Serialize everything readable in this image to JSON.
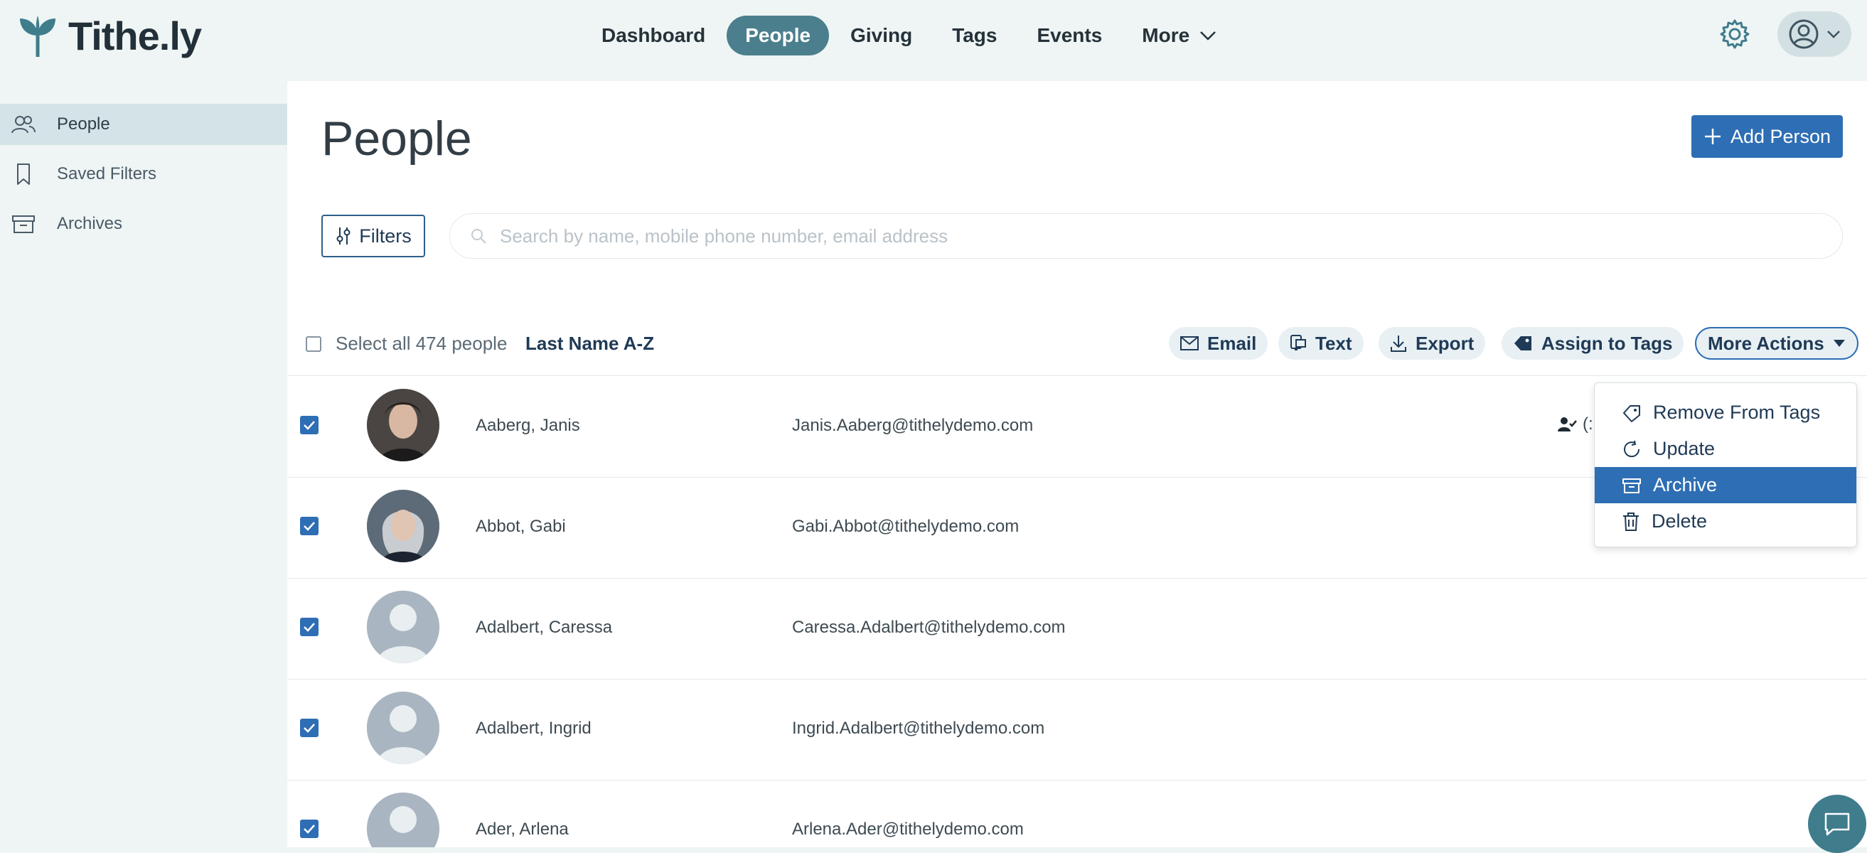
{
  "app": {
    "logo_text": "Tithe.ly",
    "brand_color": "#3f7c8c",
    "accent_color": "#2e6eb4"
  },
  "nav": {
    "items": [
      {
        "label": "Dashboard"
      },
      {
        "label": "People"
      },
      {
        "label": "Giving"
      },
      {
        "label": "Tags"
      },
      {
        "label": "Events"
      },
      {
        "label": "More"
      }
    ],
    "active": "People"
  },
  "sidebar": {
    "items": [
      {
        "label": "People",
        "icon": "people-icon"
      },
      {
        "label": "Saved Filters",
        "icon": "bookmark-icon"
      },
      {
        "label": "Archives",
        "icon": "archive-icon"
      }
    ],
    "active": "People"
  },
  "main": {
    "title": "People",
    "add_button": "Add Person",
    "filters_button": "Filters",
    "search_placeholder": "Search by name, mobile phone number, email address"
  },
  "bulk": {
    "select_all_label": "Select all 474 people",
    "sort_label": "Last Name A-Z",
    "actions": {
      "email": "Email",
      "text": "Text",
      "export": "Export",
      "assign": "Assign to Tags",
      "more": "More Actions"
    }
  },
  "dropdown": {
    "items": [
      {
        "label": "Remove From Tags",
        "icon": "tag-outline-icon"
      },
      {
        "label": "Update",
        "icon": "refresh-icon"
      },
      {
        "label": "Archive",
        "icon": "archive-icon"
      },
      {
        "label": "Delete",
        "icon": "trash-icon"
      }
    ],
    "highlighted": "Archive"
  },
  "people": [
    {
      "name": "Aaberg, Janis",
      "email": "Janis.Aaberg@tithelydemo.com",
      "household": "(:",
      "checked": true
    },
    {
      "name": "Abbot, Gabi",
      "email": "Gabi.Abbot@tithelydemo.com",
      "checked": true
    },
    {
      "name": "Adalbert, Caressa",
      "email": "Caressa.Adalbert@tithelydemo.com",
      "checked": true
    },
    {
      "name": "Adalbert, Ingrid",
      "email": "Ingrid.Adalbert@tithelydemo.com",
      "checked": true
    },
    {
      "name": "Ader, Arlena",
      "email": "Arlena.Ader@tithelydemo.com",
      "checked": true
    }
  ]
}
